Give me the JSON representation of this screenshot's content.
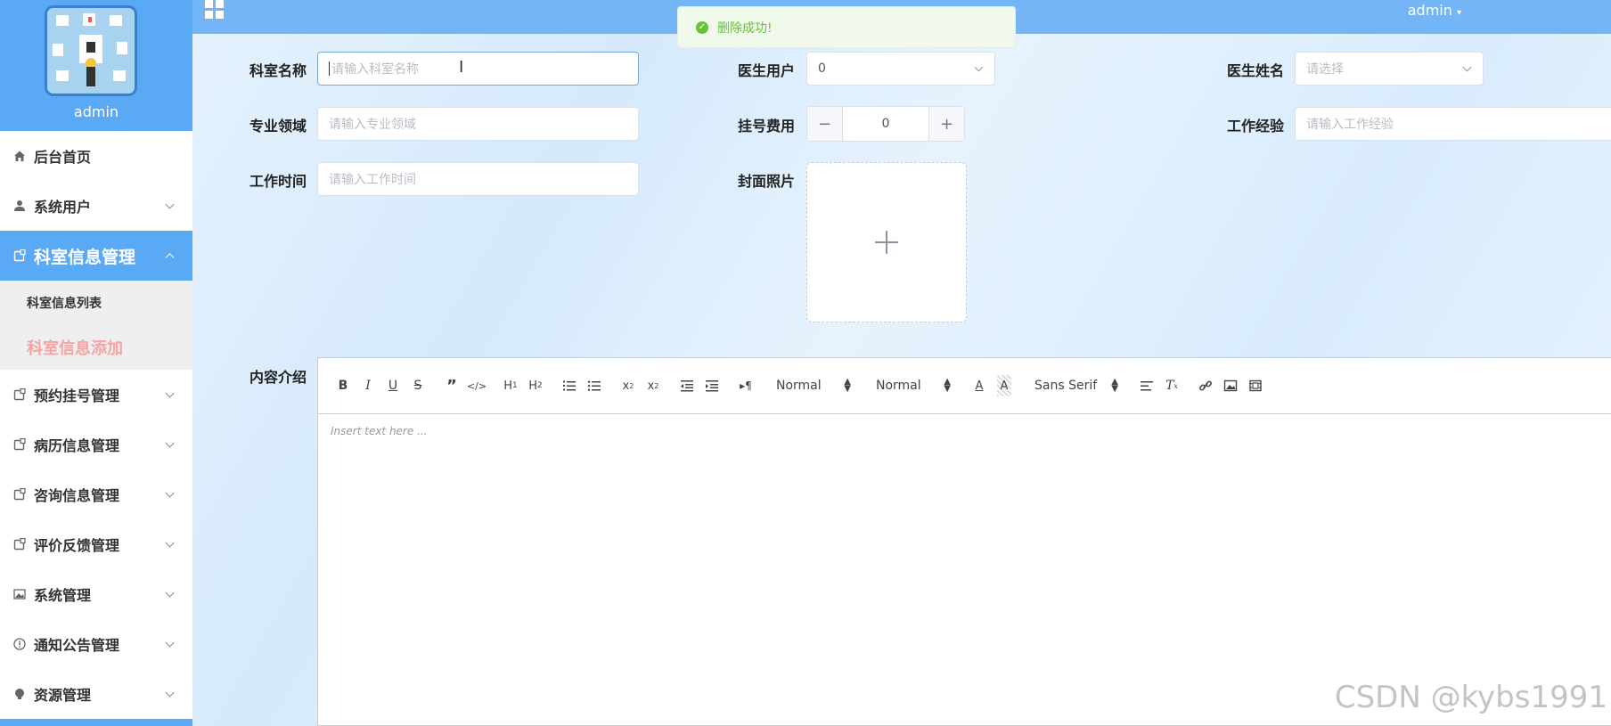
{
  "sidebar": {
    "username": "admin",
    "menu": [
      {
        "label": "后台首页",
        "icon": "home-icon"
      },
      {
        "label": "系统用户",
        "icon": "user-icon"
      },
      {
        "label": "科室信息管理",
        "icon": "doc-icon"
      },
      {
        "label": "预约挂号管理",
        "icon": "doc-icon"
      },
      {
        "label": "病历信息管理",
        "icon": "doc-icon"
      },
      {
        "label": "咨询信息管理",
        "icon": "doc-icon"
      },
      {
        "label": "评价反馈管理",
        "icon": "doc-icon"
      },
      {
        "label": "系统管理",
        "icon": "image-icon"
      },
      {
        "label": "通知公告管理",
        "icon": "info-icon"
      },
      {
        "label": "资源管理",
        "icon": "bulb-icon"
      }
    ],
    "submenu": [
      "科室信息列表",
      "科室信息添加"
    ]
  },
  "topbar": {
    "admin": "admin"
  },
  "toast": {
    "message": "删除成功!"
  },
  "form": {
    "dept_name": {
      "label": "科室名称",
      "placeholder": "请输入科室名称"
    },
    "doctor_user": {
      "label": "医生用户",
      "value": "0"
    },
    "doctor_name": {
      "label": "医生姓名",
      "placeholder": "请选择"
    },
    "specialty": {
      "label": "专业领域",
      "placeholder": "请输入专业领域"
    },
    "fee": {
      "label": "挂号费用",
      "value": "0"
    },
    "experience": {
      "label": "工作经验",
      "placeholder": "请输入工作经验"
    },
    "work_time": {
      "label": "工作时间",
      "placeholder": "请输入工作时间"
    },
    "cover": {
      "label": "封面照片"
    },
    "content": {
      "label": "内容介绍"
    }
  },
  "editor": {
    "header_select": "Normal",
    "size_select": "Normal",
    "font_select": "Sans Serif",
    "placeholder": "Insert text here ..."
  },
  "watermark": "CSDN @kybs1991"
}
